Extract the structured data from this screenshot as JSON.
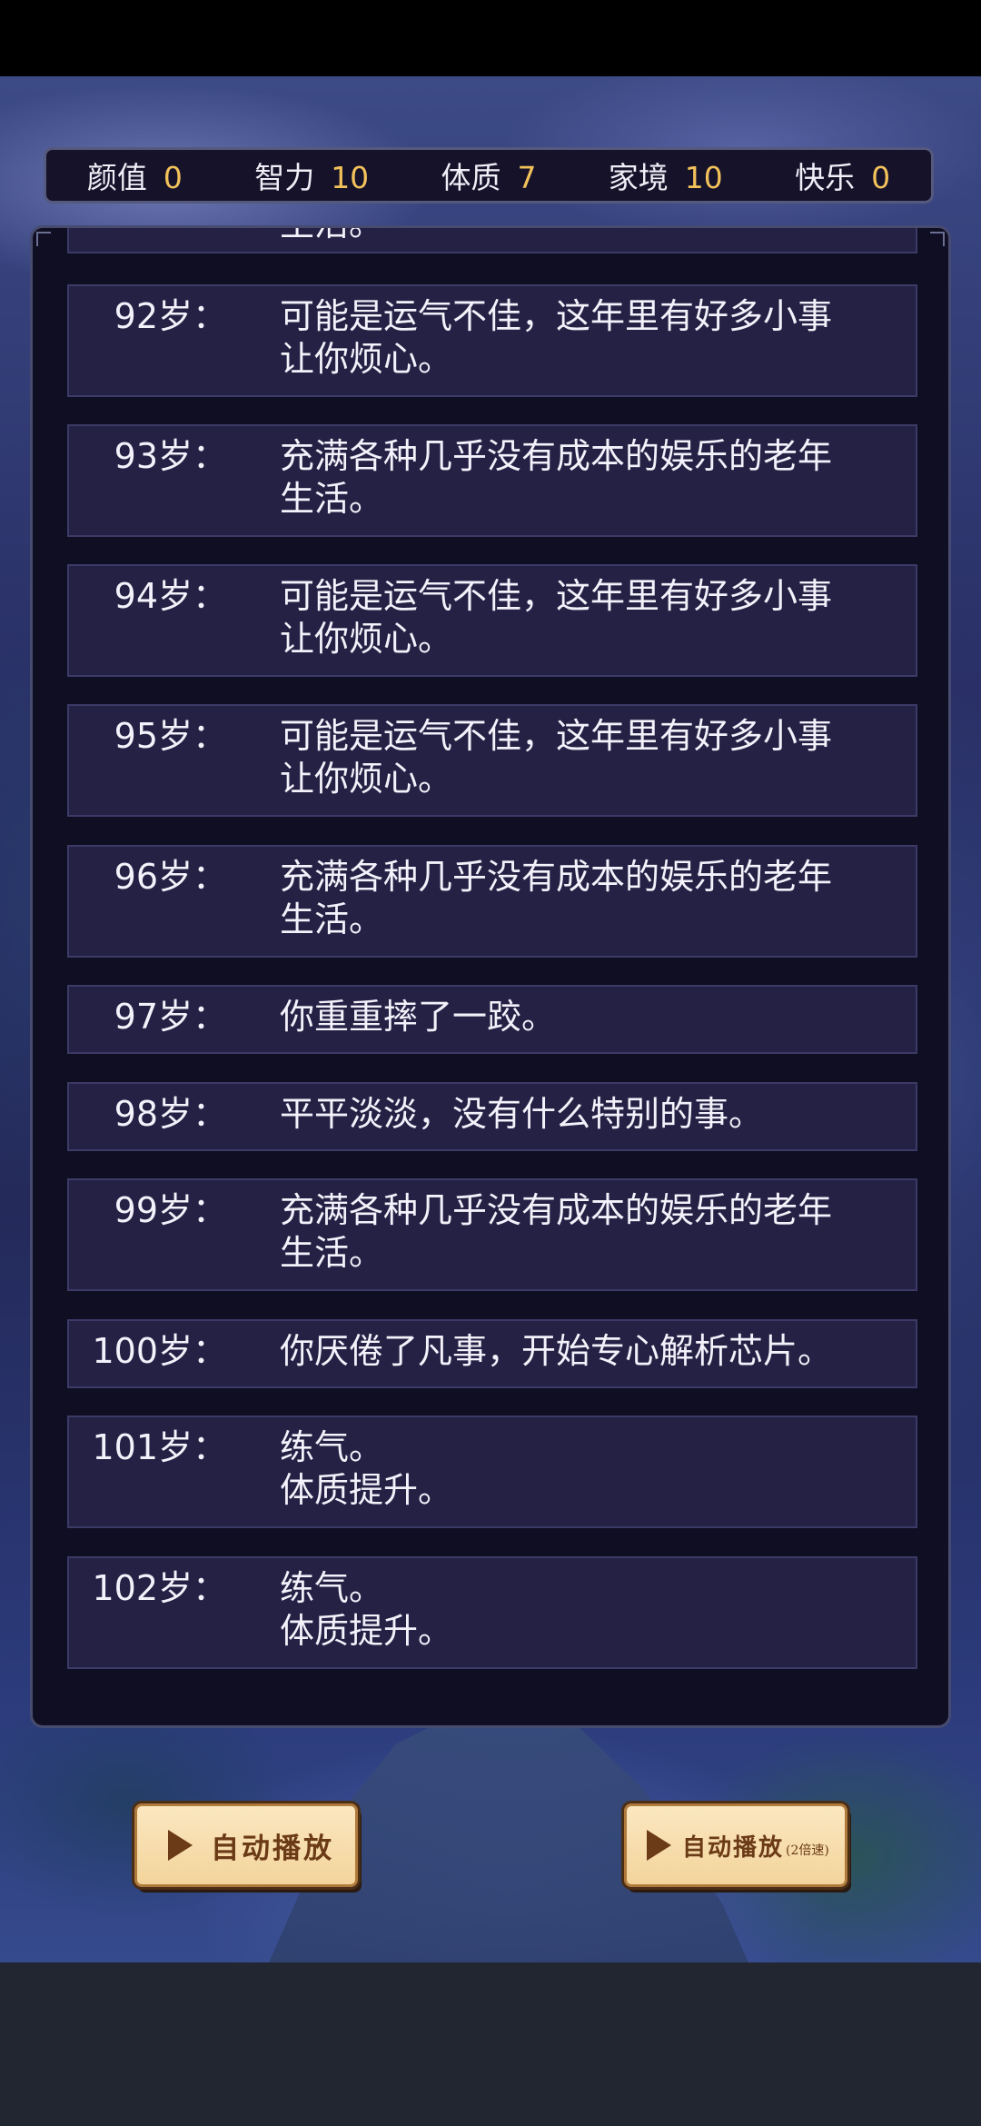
{
  "stats": [
    {
      "label": "颜值",
      "value": "0"
    },
    {
      "label": "智力",
      "value": "10"
    },
    {
      "label": "体质",
      "value": "7"
    },
    {
      "label": "家境",
      "value": "10"
    },
    {
      "label": "快乐",
      "value": "0"
    }
  ],
  "events": [
    {
      "age": "",
      "text": "生活。"
    },
    {
      "age": "92岁：",
      "text": "可能是运气不佳，这年里有好多小事\n让你烦心。"
    },
    {
      "age": "93岁：",
      "text": "充满各种几乎没有成本的娱乐的老年\n生活。"
    },
    {
      "age": "94岁：",
      "text": "可能是运气不佳，这年里有好多小事\n让你烦心。"
    },
    {
      "age": "95岁：",
      "text": "可能是运气不佳，这年里有好多小事\n让你烦心。"
    },
    {
      "age": "96岁：",
      "text": "充满各种几乎没有成本的娱乐的老年\n生活。"
    },
    {
      "age": "97岁：",
      "text": "你重重摔了一跤。"
    },
    {
      "age": "98岁：",
      "text": "平平淡淡，没有什么特别的事。"
    },
    {
      "age": "99岁：",
      "text": "充满各种几乎没有成本的娱乐的老年\n生活。"
    },
    {
      "age": "100岁：",
      "text": "你厌倦了凡事，开始专心解析芯片。"
    },
    {
      "age": "101岁：",
      "text": "练气。\n体质提升。"
    },
    {
      "age": "102岁：",
      "text": "练气。\n体质提升。"
    }
  ],
  "buttons": {
    "auto_play": {
      "label": "自动播放"
    },
    "auto_play_2x": {
      "label": "自动播放",
      "note": "(2倍速)"
    }
  }
}
